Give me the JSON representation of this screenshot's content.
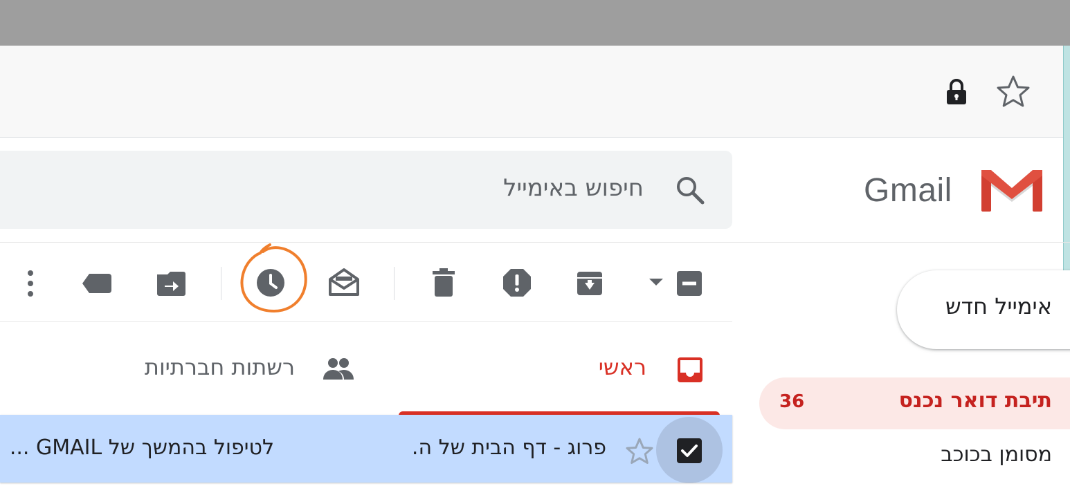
{
  "browser": {
    "lock_icon": "lock-icon",
    "bookmark_icon": "star-outline-icon"
  },
  "app": {
    "logo_word": "Gmail",
    "logo_icon": "gmail-m-logo"
  },
  "search": {
    "placeholder": "חיפוש באימייל",
    "icon": "search-icon"
  },
  "toolbar": {
    "icons": [
      "select-all-checkbox-icon",
      "chevron-down-icon",
      "archive-icon",
      "report-spam-icon",
      "delete-icon",
      "mark-as-read-icon",
      "snooze-icon",
      "move-to-icon",
      "label-icon",
      "more-vert-icon"
    ],
    "highlight_color": "#f07f2d"
  },
  "sidebar": {
    "compose_label": "אימייל חדש",
    "items": [
      {
        "label": "תיבת דואר נכנס",
        "count": "36",
        "active": true
      },
      {
        "label": "מסומן בכוכב"
      }
    ]
  },
  "tabs": [
    {
      "label": "ראשי",
      "icon": "inbox-icon",
      "active": true
    },
    {
      "label": "רשתות חברתיות",
      "icon": "people-icon"
    }
  ],
  "rows": [
    {
      "sender": "פרוג - דף הבית של ה.",
      "subject": "לטיפול בהמשך של GMAIL ...",
      "checked": true,
      "starred": false
    }
  ],
  "colors": {
    "accent_red": "#d93025",
    "inbox_bg": "#fce8e6",
    "selected_row": "#c2dbff",
    "icon_gray": "#5f6368"
  }
}
